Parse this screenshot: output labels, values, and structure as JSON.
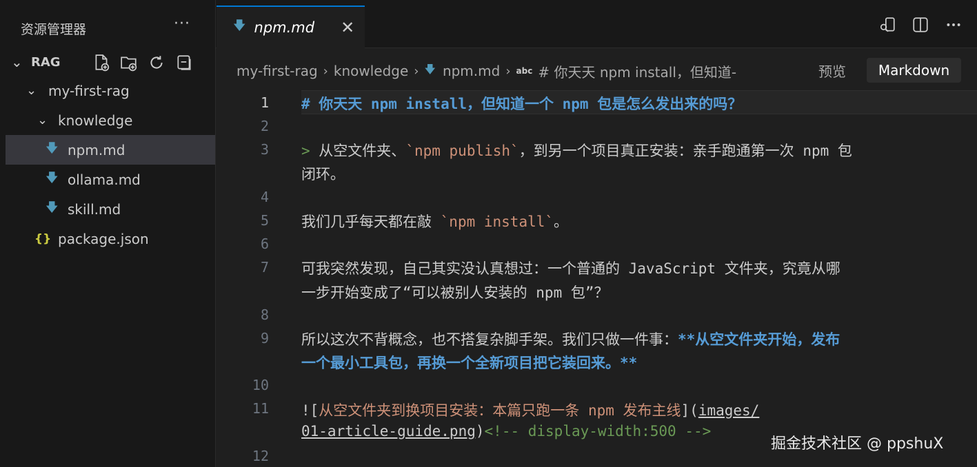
{
  "sidebar": {
    "title": "资源管理器",
    "more": "···",
    "section": "RAG",
    "tree": [
      {
        "label": "my-first-rag",
        "kind": "folder"
      },
      {
        "label": "knowledge",
        "kind": "folder"
      },
      {
        "label": "npm.md",
        "kind": "md",
        "selected": true
      },
      {
        "label": "ollama.md",
        "kind": "md"
      },
      {
        "label": "skill.md",
        "kind": "md"
      },
      {
        "label": "package.json",
        "kind": "json"
      }
    ],
    "json_icon": "{}"
  },
  "tab": {
    "label": "npm.md",
    "close": "✕"
  },
  "breadcrumb": {
    "items": [
      "my-first-rag",
      "knowledge",
      "npm.md"
    ],
    "symbol_tag": "abc",
    "symbol": "# 你天天 npm install，但知道-"
  },
  "toolbar": {
    "preview_label": "预览",
    "language_label": "Markdown"
  },
  "editor": {
    "lines": {
      "l1": "# 你天天 npm install，但知道一个 npm 包是怎么发出来的吗？",
      "l3_marker": ">",
      "l3_a": " 从空文件夹、",
      "l3_code": "`npm publish`",
      "l3_b": "，到另一个项目真正安装：亲手跑通第一次 npm 包",
      "l3_wrap": "闭环。",
      "l5_a": "我们几乎每天都在敲 ",
      "l5_code": "`npm install`",
      "l5_b": "。",
      "l7": "可我突然发现，自己其实没认真想过：一个普通的 JavaScript 文件夹，究竟从哪",
      "l7_wrap": "一步开始变成了“可以被别人安装的 npm 包”？",
      "l9_a": "所以这次不背概念，也不搭复杂脚手架。我们只做一件事：",
      "l9_bold": "**从空文件夹开始，发布",
      "l9_wrap": "一个最小工具包，再换一个全新项目把它装回来。**",
      "l11_open": "![",
      "l11_alt": "从空文件夹到换项目安装：本篇只跑一条 npm 发布主线",
      "l11_mid": "](",
      "l11_link": "images/",
      "l11_wrap_link": "01-article-guide.png",
      "l11_close": ")",
      "l11_comment": "<!-- display-width:500 -->"
    },
    "numbers": [
      "1",
      "2",
      "3",
      "4",
      "5",
      "6",
      "7",
      "8",
      "9",
      "10",
      "11",
      "12"
    ]
  },
  "watermark": "掘金技术社区 @ ppshuX",
  "colors": {
    "accent": "#0078d4",
    "heading": "#569cd6",
    "code": "#ce9178",
    "comment": "#6a9955",
    "md_icon": "#519aba"
  }
}
